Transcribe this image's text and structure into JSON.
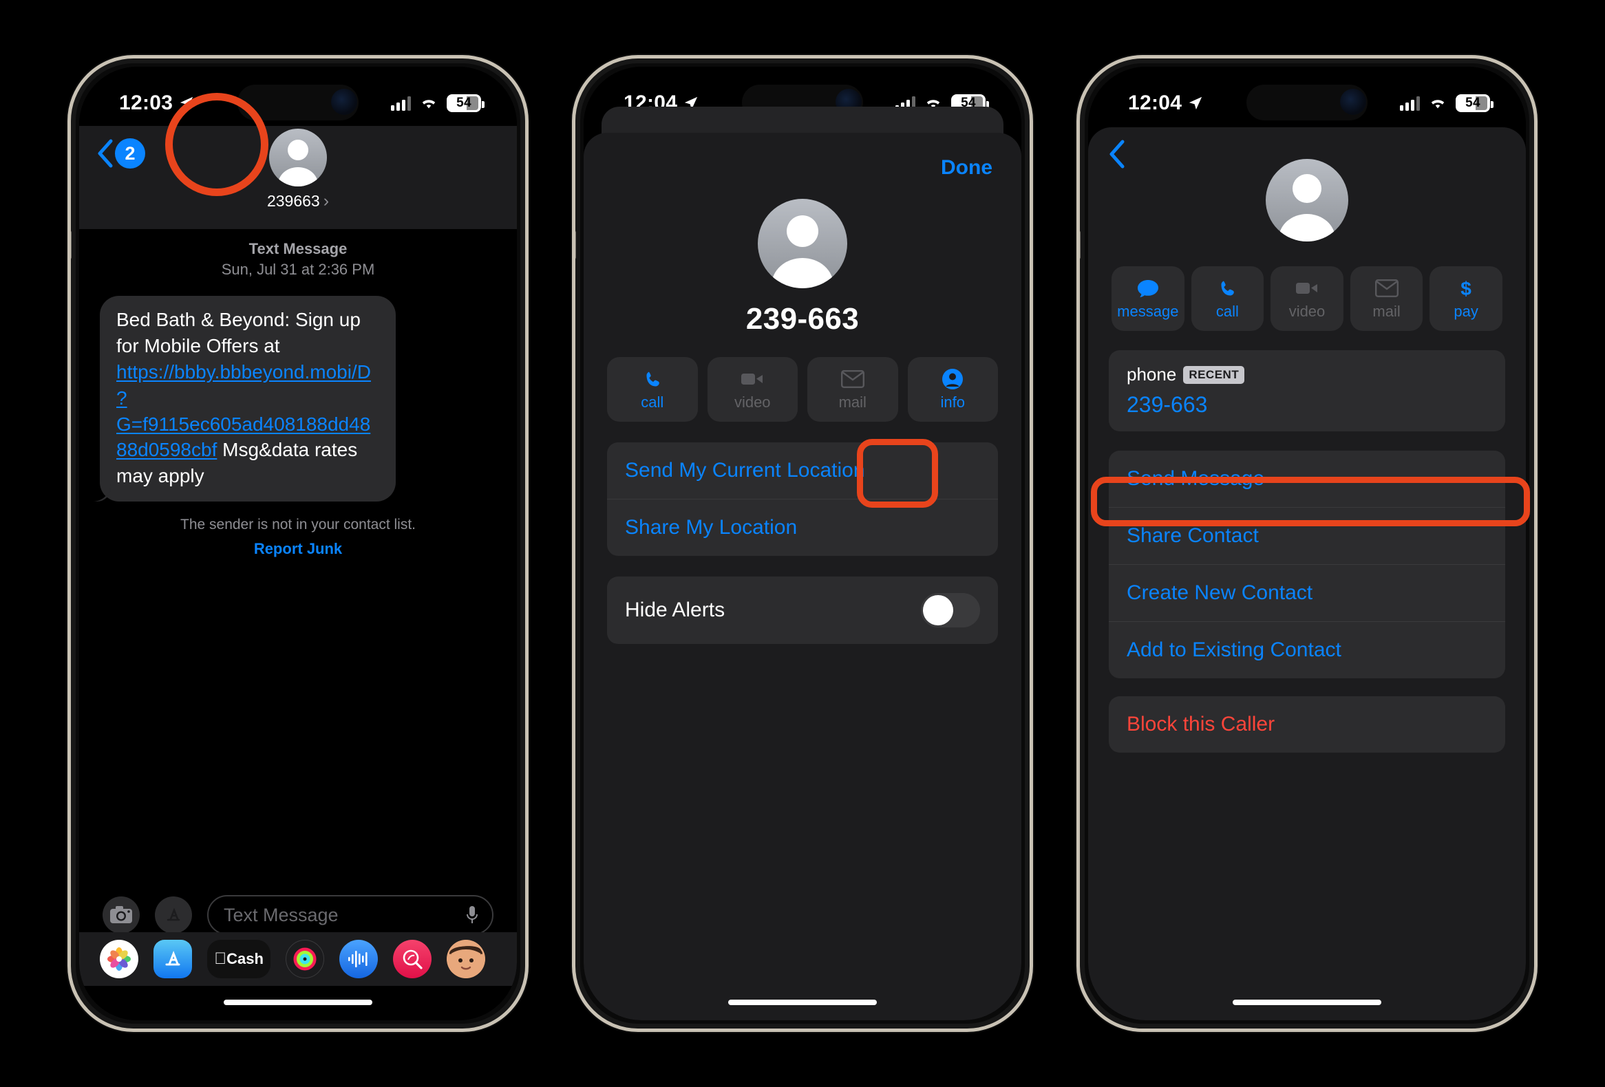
{
  "phone1": {
    "status": {
      "time": "12:03",
      "battery": "54",
      "location_icon": "location-arrow-icon",
      "wifi_icon": "wifi-icon",
      "cellular_icon": "cellular-bars-icon"
    },
    "header": {
      "back_badge": "2",
      "contact_name": "239663",
      "chevron": "›",
      "avatar_icon": "person-avatar-icon"
    },
    "meta": {
      "type": "Text Message",
      "timestamp": "Sun, Jul 31 at 2:36 PM"
    },
    "message": {
      "prefix": "Bed Bath & Beyond: Sign up for Mobile Offers at ",
      "link": "https://bbby.bbbeyond.mobi/D?G=f9115ec605ad408188dd4888d0598cbf",
      "suffix": " Msg&data rates may apply"
    },
    "notice": {
      "text": "The sender is not in your contact list.",
      "action": "Report Junk"
    },
    "composer": {
      "camera_icon": "camera-icon",
      "apps_icon": "app-store-icon",
      "placeholder": "Text Message",
      "mic_icon": "microphone-icon"
    },
    "dock": [
      {
        "name": "photos",
        "label": ""
      },
      {
        "name": "app-store",
        "label": ""
      },
      {
        "name": "apple-cash",
        "label": "Cash"
      },
      {
        "name": "fitness",
        "label": ""
      },
      {
        "name": "voice-memos",
        "label": ""
      },
      {
        "name": "music-search",
        "label": ""
      },
      {
        "name": "memoji",
        "label": ""
      }
    ]
  },
  "phone2": {
    "status": {
      "time": "12:04",
      "battery": "54"
    },
    "done_label": "Done",
    "contact_name": "239-663",
    "actions": [
      {
        "name": "call",
        "label": "call",
        "enabled": true,
        "icon": "phone-icon"
      },
      {
        "name": "video",
        "label": "video",
        "enabled": false,
        "icon": "video-camera-icon"
      },
      {
        "name": "mail",
        "label": "mail",
        "enabled": false,
        "icon": "envelope-icon"
      },
      {
        "name": "info",
        "label": "info",
        "enabled": true,
        "icon": "person-circle-icon"
      }
    ],
    "location_rows": [
      "Send My Current Location",
      "Share My Location"
    ],
    "hide_alerts": {
      "label": "Hide Alerts",
      "on": false
    }
  },
  "phone3": {
    "status": {
      "time": "12:04",
      "battery": "54"
    },
    "actions": [
      {
        "name": "message",
        "label": "message",
        "enabled": true,
        "icon": "message-bubble-icon"
      },
      {
        "name": "call",
        "label": "call",
        "enabled": true,
        "icon": "phone-icon"
      },
      {
        "name": "video",
        "label": "video",
        "enabled": false,
        "icon": "video-camera-icon"
      },
      {
        "name": "mail",
        "label": "mail",
        "enabled": false,
        "icon": "envelope-icon"
      },
      {
        "name": "pay",
        "label": "pay",
        "enabled": true,
        "icon": "dollar-sign-icon"
      }
    ],
    "phone_field": {
      "label": "phone",
      "badge": "RECENT",
      "value": "239-663"
    },
    "list_rows": [
      "Send Message",
      "Share Contact",
      "Create New Contact",
      "Add to Existing Contact"
    ],
    "block_row": "Block this Caller"
  },
  "highlight_color": "#e8441c",
  "accent_color": "#0a84ff",
  "danger_color": "#ff453a"
}
